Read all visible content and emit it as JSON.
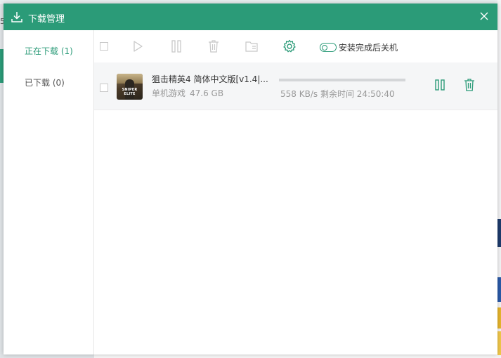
{
  "window": {
    "title": "下载管理"
  },
  "background": {
    "left_edge_char": "5"
  },
  "sidebar": {
    "items": [
      {
        "label": "正在下载 (1)",
        "active": true
      },
      {
        "label": "已下载 (0)",
        "active": false
      }
    ]
  },
  "toolbar": {
    "icons": [
      "select-all-checkbox",
      "start-icon",
      "pause-icon",
      "trash-icon",
      "folder-icon",
      "gear-icon"
    ],
    "shutdown_toggle": {
      "label": "安装完成后关机",
      "on": false
    }
  },
  "downloads": [
    {
      "name": "狙击精英4  简体中文版[v1.4|...",
      "category": "单机游戏",
      "size": "47.6 GB",
      "speed": "558 KB/s",
      "remaining_label": "剩余时间",
      "remaining": "24:50:40",
      "progress": 0.0,
      "thumb_text": "SNIPER ELITE"
    }
  ],
  "colors": {
    "accent": "#2b9b78"
  }
}
